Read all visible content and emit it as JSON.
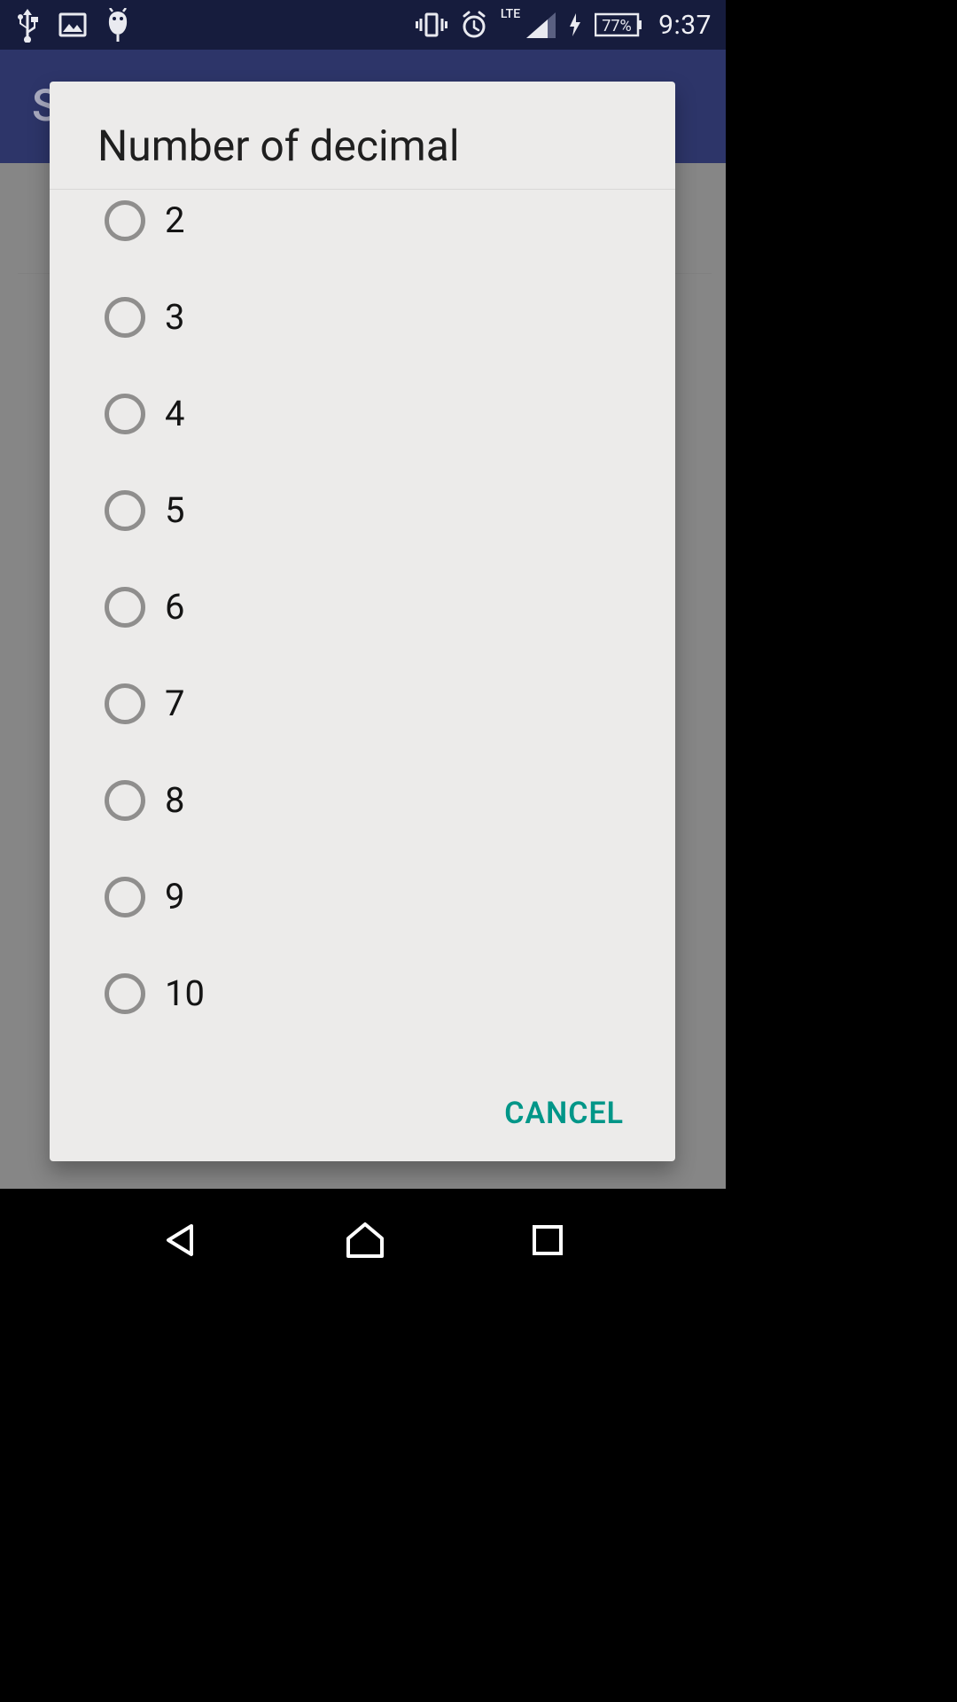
{
  "status": {
    "time": "9:37",
    "battery_percent": "77%",
    "lte": "LTE"
  },
  "appbar": {
    "title": "S"
  },
  "dialog": {
    "title": "Number of decimal",
    "options": [
      "2",
      "3",
      "4",
      "5",
      "6",
      "7",
      "8",
      "9",
      "10"
    ],
    "cancel": "CANCEL"
  },
  "colors": {
    "accent": "#009688",
    "statusbar": "#161c3d",
    "appbar": "#2d3569",
    "dialog_bg": "#ecebea"
  }
}
